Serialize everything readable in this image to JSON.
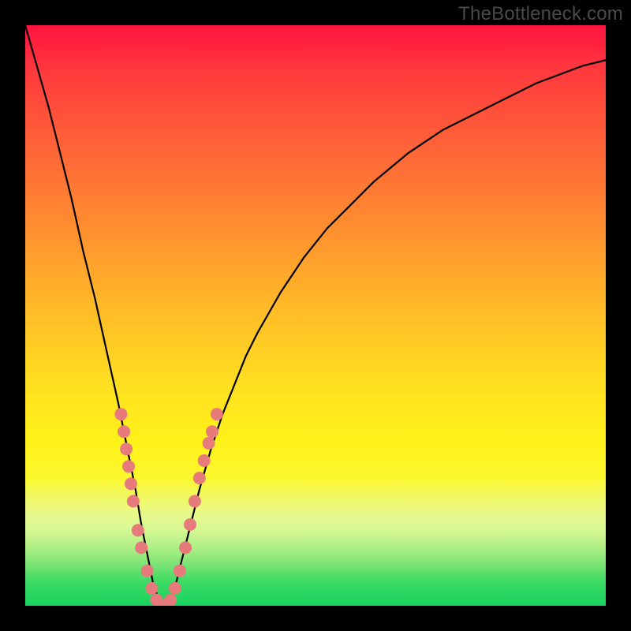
{
  "watermark": "TheBottleneck.com",
  "colors": {
    "curve": "#000000",
    "marker_fill": "#e77b7b",
    "marker_stroke": "#d86868",
    "frame": "#000000"
  },
  "chart_data": {
    "type": "line",
    "title": "",
    "xlabel": "",
    "ylabel": "",
    "xlim": [
      0,
      100
    ],
    "ylim": [
      0,
      100
    ],
    "curve": {
      "x": [
        0,
        2,
        4,
        6,
        8,
        10,
        12,
        14,
        16,
        17,
        18,
        19,
        20,
        21,
        22,
        23,
        24,
        25,
        26,
        27,
        28,
        30,
        32,
        34,
        36,
        38,
        40,
        44,
        48,
        52,
        56,
        60,
        66,
        72,
        80,
        88,
        96,
        100
      ],
      "y": [
        100,
        93,
        86,
        78,
        70,
        61,
        53,
        44,
        35,
        30,
        25,
        20,
        14,
        9,
        4,
        1,
        0,
        1,
        4,
        8,
        12,
        20,
        27,
        33,
        38,
        43,
        47,
        54,
        60,
        65,
        69,
        73,
        78,
        82,
        86,
        90,
        93,
        94
      ]
    },
    "markers": {
      "comment": "approximate salmon dot clusters along lower V",
      "points": [
        {
          "x": 16.5,
          "y": 33
        },
        {
          "x": 17.0,
          "y": 30
        },
        {
          "x": 17.4,
          "y": 27
        },
        {
          "x": 17.8,
          "y": 24
        },
        {
          "x": 18.2,
          "y": 21
        },
        {
          "x": 18.6,
          "y": 18
        },
        {
          "x": 19.4,
          "y": 13
        },
        {
          "x": 20.0,
          "y": 10
        },
        {
          "x": 21.0,
          "y": 6
        },
        {
          "x": 21.8,
          "y": 3
        },
        {
          "x": 22.6,
          "y": 1
        },
        {
          "x": 23.4,
          "y": 0
        },
        {
          "x": 24.2,
          "y": 0
        },
        {
          "x": 25.0,
          "y": 1
        },
        {
          "x": 25.8,
          "y": 3
        },
        {
          "x": 26.6,
          "y": 6
        },
        {
          "x": 27.6,
          "y": 10
        },
        {
          "x": 28.4,
          "y": 14
        },
        {
          "x": 29.2,
          "y": 18
        },
        {
          "x": 30.0,
          "y": 22
        },
        {
          "x": 30.8,
          "y": 25
        },
        {
          "x": 31.6,
          "y": 28
        },
        {
          "x": 32.2,
          "y": 30
        },
        {
          "x": 33.0,
          "y": 33
        }
      ],
      "radius": 8
    }
  }
}
